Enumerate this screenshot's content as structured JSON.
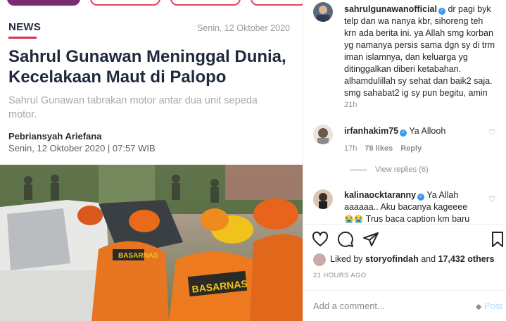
{
  "article": {
    "tag": "NEWS",
    "date": "Senin, 12 Oktober 2020",
    "headline": "Sahrul Gunawan Meninggal Dunia, Kecelakaan Maut di Palopo",
    "subhead": "Sahrul Gunawan tabrakan motor antar dua unit sepeda motor.",
    "author": "Pebriansyah Ariefana",
    "byline_date": "Senin, 12 Oktober 2020 | 07:57 WIB",
    "photo_text": "BASARNAS",
    "accent_color": "#d8344a"
  },
  "caption": {
    "username": "sahrulgunawanofficial",
    "text": "dr pagi byk telp dan wa nanya kbr, sihoreng teh krn ada berita ini. ya Allah smg korban yg namanya persis sama dgn sy di trm iman islamnya, dan keluarga yg ditinggalkan diberi ketabahan. alhamdulillah sy sehat dan baik2 saja. smg sahabat2 ig sy pun begitu, amin",
    "time": "21h"
  },
  "comments": [
    {
      "username": "irfanhakim75",
      "text": "Ya Allooh",
      "time": "17h",
      "likes": "78 likes",
      "reply": "Reply",
      "view_replies": "View replies (6)"
    },
    {
      "username": "kalinaocktaranny",
      "text": "Ya Allah aaaaaa.. Aku bacanya kageeee",
      "text2": "Trus baca caption km baru"
    }
  ],
  "likes": {
    "prefix": "Liked by",
    "user": "storyofindah",
    "and": "and",
    "count": "17,432 others"
  },
  "post_time": "21 HOURS AGO",
  "add_comment": {
    "placeholder": "Add a comment...",
    "post_label": "Post"
  }
}
